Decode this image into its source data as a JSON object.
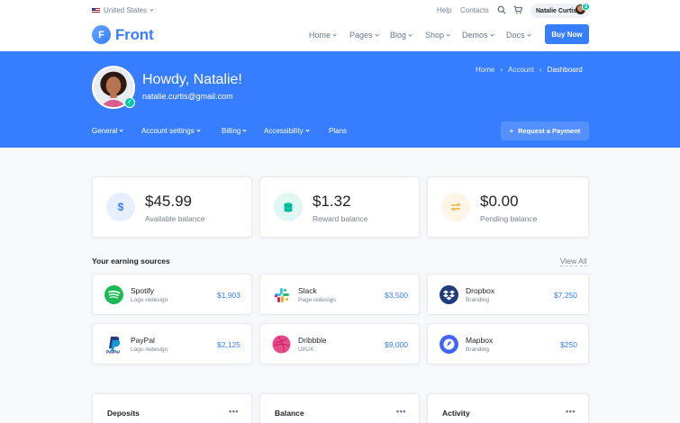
{
  "topbar": {
    "language": "United States",
    "help": "Help",
    "contacts": "Contacts",
    "user_name": "Natalie Curtis",
    "notification_count": "3"
  },
  "brand": {
    "logo_letter": "F",
    "name": "Front"
  },
  "nav": {
    "items": [
      "Home",
      "Pages",
      "Blog",
      "Shop",
      "Demos",
      "Docs"
    ],
    "buy_label": "Buy Now"
  },
  "hero": {
    "greeting": "Howdy, Natalie!",
    "email": "natalie.curtis@gmail.com",
    "breadcrumb": [
      "Home",
      "Account",
      "Dashboard"
    ],
    "subnav": [
      "General",
      "Account settings",
      "Billing",
      "Accessibility",
      "Plans"
    ],
    "request_label": "Request a Payment"
  },
  "balances": [
    {
      "amount": "$45.99",
      "label": "Available balance",
      "symbol": "$",
      "color": "#377dff",
      "bg": "#e7efff"
    },
    {
      "amount": "$1.32",
      "label": "Reward balance",
      "symbol": "coins-icon",
      "color": "#00c9a7",
      "bg": "#e0f7f3"
    },
    {
      "amount": "$0.00",
      "label": "Pending balance",
      "symbol": "swap-icon",
      "color": "#f5ca99",
      "bg": "#fdf5e6"
    }
  ],
  "earnings": {
    "title": "Your earning sources",
    "view_all": "View All",
    "sources": [
      {
        "name": "Spotify",
        "desc": "Logo redesign",
        "amount": "$1,903"
      },
      {
        "name": "Slack",
        "desc": "Page redesign",
        "amount": "$3,500"
      },
      {
        "name": "Dropbox",
        "desc": "Branding",
        "amount": "$7,250"
      },
      {
        "name": "PayPal",
        "desc": "Logo redesign",
        "amount": "$2,125"
      },
      {
        "name": "Dribbble",
        "desc": "UI/UX",
        "amount": "$9,000"
      },
      {
        "name": "Mapbox",
        "desc": "Branding",
        "amount": "$250"
      }
    ]
  },
  "bottom_cards": [
    "Deposits",
    "Balance",
    "Activity"
  ]
}
